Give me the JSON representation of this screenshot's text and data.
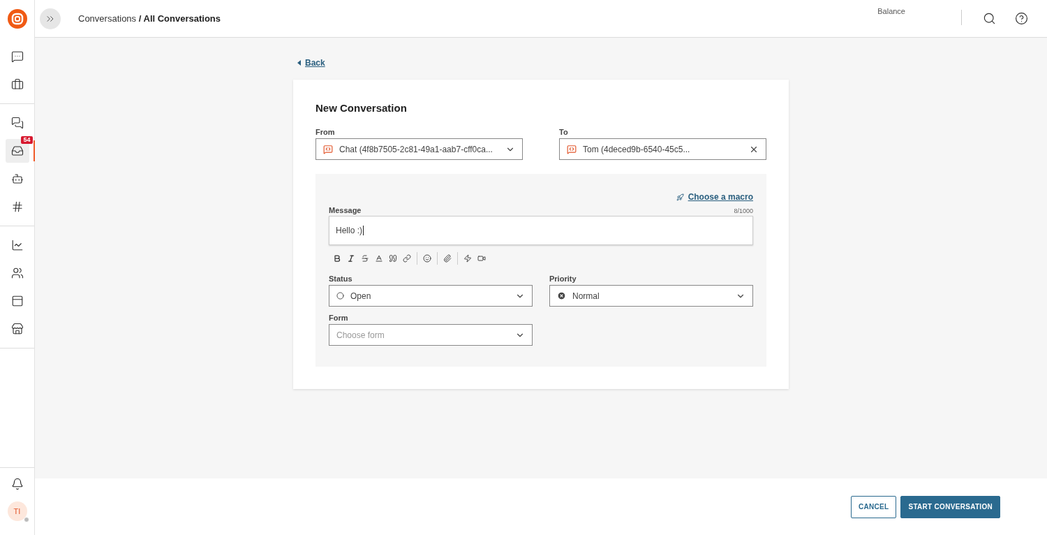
{
  "sidebar": {
    "groups": [
      [
        {
          "selected": false
        },
        {
          "selected": false
        }
      ],
      [
        {
          "selected": false
        },
        {
          "selected": true,
          "badge": "54"
        },
        {
          "selected": false
        },
        {
          "selected": false
        }
      ],
      [
        {
          "selected": false
        },
        {
          "selected": false
        },
        {
          "selected": false
        },
        {
          "selected": false
        }
      ]
    ],
    "avatar": "TI"
  },
  "header": {
    "breadcrumb": "Conversations",
    "separator": "/",
    "current": "All Conversations",
    "balance_label": "Balance"
  },
  "back": "Back",
  "form": {
    "title": "New Conversation",
    "from": {
      "label": "From",
      "value": "Chat (4f8b7505-2c81-49a1-aab7-cff0ca..."
    },
    "to": {
      "label": "To",
      "value": "Tom  (4deced9b-6540-45c5..."
    },
    "macro": "Choose a macro",
    "message": {
      "label": "Message",
      "counter": "8/1000",
      "value": "Hello :)"
    },
    "status": {
      "label": "Status",
      "value": "Open"
    },
    "priority": {
      "label": "Priority",
      "value": "Normal"
    },
    "form_field": {
      "label": "Form",
      "placeholder": "Choose form"
    }
  },
  "buttons": {
    "cancel": "CANCEL",
    "start": "START CONVERSATION"
  }
}
